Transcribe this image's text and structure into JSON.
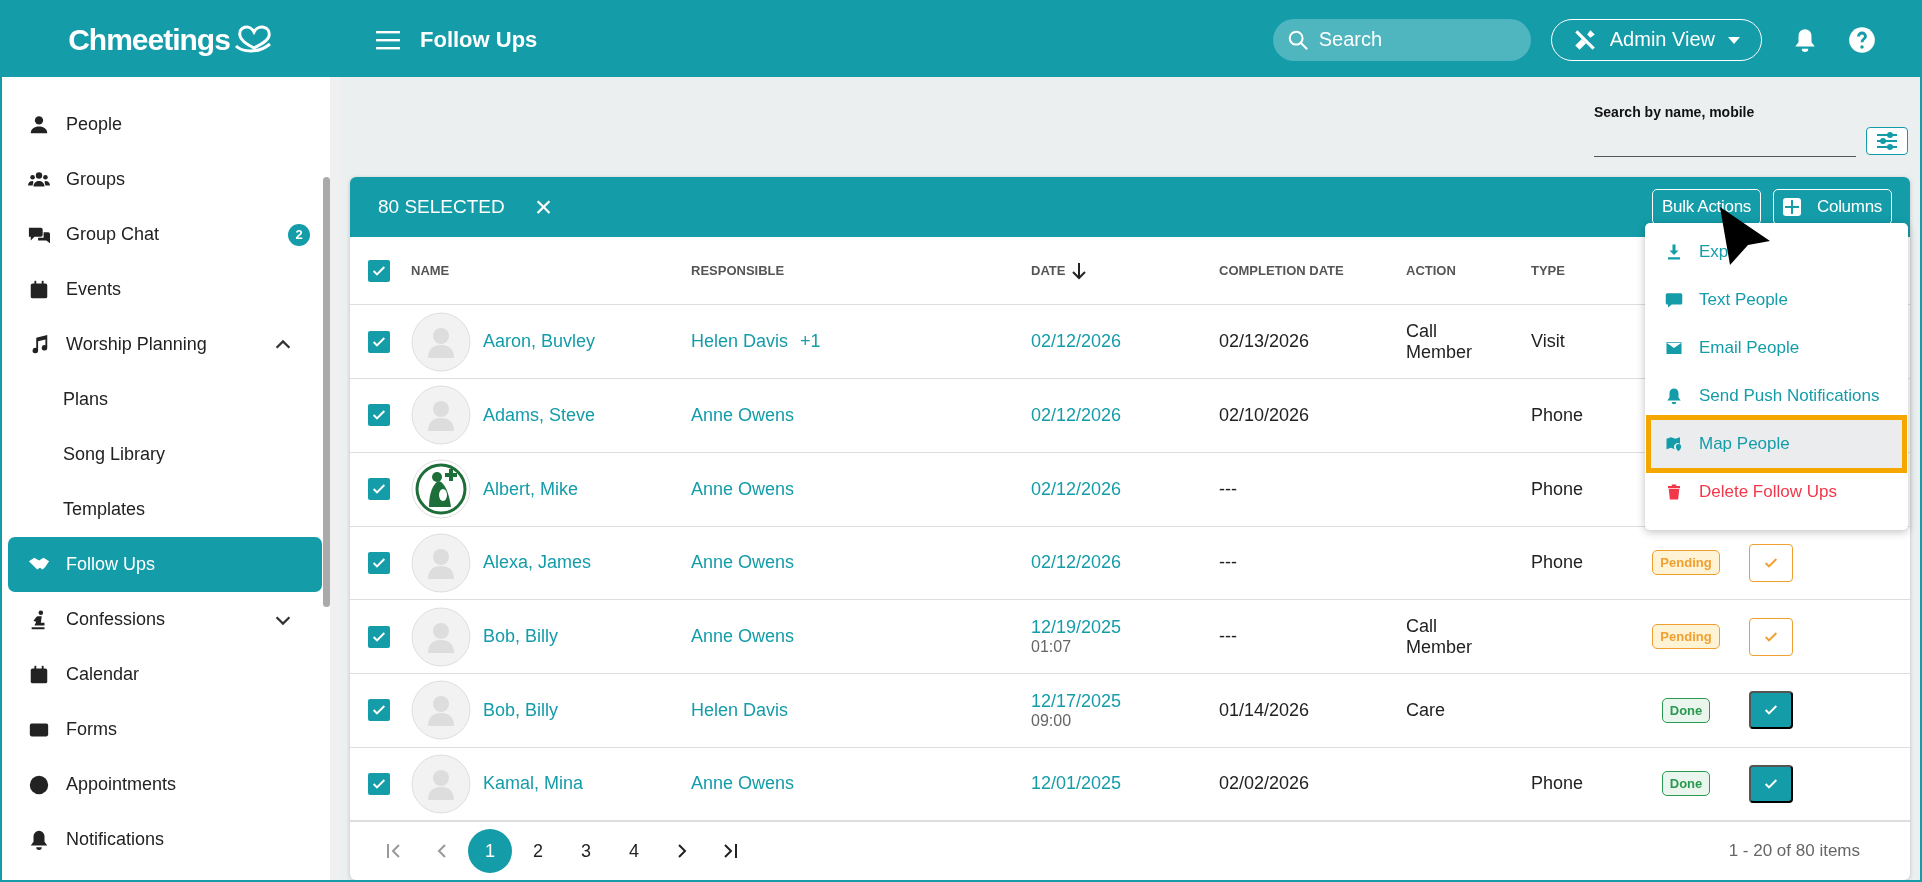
{
  "header": {
    "logo": "Chmeetings",
    "title": "Follow Ups",
    "search": {
      "placeholder": "Search"
    },
    "view_button": "Admin View"
  },
  "sidebar": {
    "items": [
      {
        "label": "People",
        "selected": false
      },
      {
        "label": "Groups",
        "selected": false
      },
      {
        "label": "Group Chat",
        "selected": false,
        "badge": "2"
      },
      {
        "label": "Events",
        "selected": false
      },
      {
        "label": "Worship Planning",
        "selected": false,
        "expanded": true,
        "children": [
          {
            "label": "Plans",
            "selected": false
          },
          {
            "label": "Song Library",
            "selected": false
          },
          {
            "label": "Templates",
            "selected": false
          }
        ]
      },
      {
        "label": "Follow Ups",
        "selected": true
      },
      {
        "label": "Confessions",
        "selected": false,
        "expanded": false
      },
      {
        "label": "Calendar",
        "selected": false
      },
      {
        "label": "Forms",
        "selected": false
      },
      {
        "label": "Appointments",
        "selected": false
      },
      {
        "label": "Notifications",
        "selected": false
      }
    ]
  },
  "filter": {
    "label": "Search by name, mobile"
  },
  "selection_bar": {
    "count": "80 SELECTED",
    "close": "×",
    "bulk_actions": "Bulk Actions",
    "columns": "Columns"
  },
  "bulk_menu": [
    {
      "label": "Exp",
      "kind": "export",
      "highlighted": false
    },
    {
      "label": "Text People",
      "kind": "text",
      "highlighted": false
    },
    {
      "label": "Email People",
      "kind": "email",
      "highlighted": false
    },
    {
      "label": "Send Push Notifications",
      "kind": "push",
      "highlighted": false
    },
    {
      "label": "Map People",
      "kind": "map",
      "highlighted": true
    },
    {
      "label": "Delete Follow Ups",
      "kind": "delete",
      "highlighted": false
    }
  ],
  "table": {
    "all_checked": true,
    "columns": [
      "NAME",
      "RESPONSIBLE",
      "DATE",
      "COMPLETION DATE",
      "ACTION",
      "TYPE"
    ],
    "rows": [
      {
        "checked": true,
        "has_photo": false,
        "name": "Aaron, Buvley",
        "responsible": "Helen Davis",
        "responsible_extra": "+1",
        "date": "02/12/2026",
        "completion": "02/13/2026",
        "action": "Call Member",
        "type": "Visit"
      },
      {
        "checked": true,
        "has_photo": false,
        "name": "Adams, Steve",
        "responsible": "Anne Owens",
        "date": "02/12/2026",
        "completion": "02/10/2026",
        "type": "Phone"
      },
      {
        "checked": true,
        "has_photo": true,
        "name": "Albert, Mike",
        "responsible": "Anne Owens",
        "date": "02/12/2026",
        "completion": "---",
        "type": "Phone"
      },
      {
        "checked": true,
        "has_photo": false,
        "name": "Alexa, James",
        "responsible": "Anne Owens",
        "date": "02/12/2026",
        "completion": "---",
        "type": "Phone",
        "status": {
          "label": "Pending",
          "kind": "pending"
        },
        "done": false
      },
      {
        "checked": true,
        "has_photo": false,
        "name": "Bob, Billy",
        "responsible": "Anne Owens",
        "date": "12/19/2025",
        "time": "01:07",
        "completion": "---",
        "action": "Call Member",
        "status": {
          "label": "Pending",
          "kind": "pending"
        },
        "done": false
      },
      {
        "checked": true,
        "has_photo": false,
        "name": "Bob, Billy",
        "responsible": "Helen Davis",
        "date": "12/17/2025",
        "time": "09:00",
        "completion": "01/14/2026",
        "action": "Care",
        "status": {
          "label": "Done",
          "kind": "done"
        },
        "done": true
      },
      {
        "checked": true,
        "has_photo": false,
        "name": "Kamal, Mina",
        "responsible": "Anne Owens",
        "date": "12/01/2025",
        "completion": "02/02/2026",
        "type": "Phone",
        "status": {
          "label": "Done",
          "kind": "done"
        },
        "done": true
      }
    ]
  },
  "pagination": {
    "pages": [
      {
        "label": "1",
        "selected": true
      },
      {
        "label": "2",
        "selected": false
      },
      {
        "label": "3",
        "selected": false
      },
      {
        "label": "4",
        "selected": false
      }
    ],
    "summary": "1 - 20 of 80 items"
  }
}
